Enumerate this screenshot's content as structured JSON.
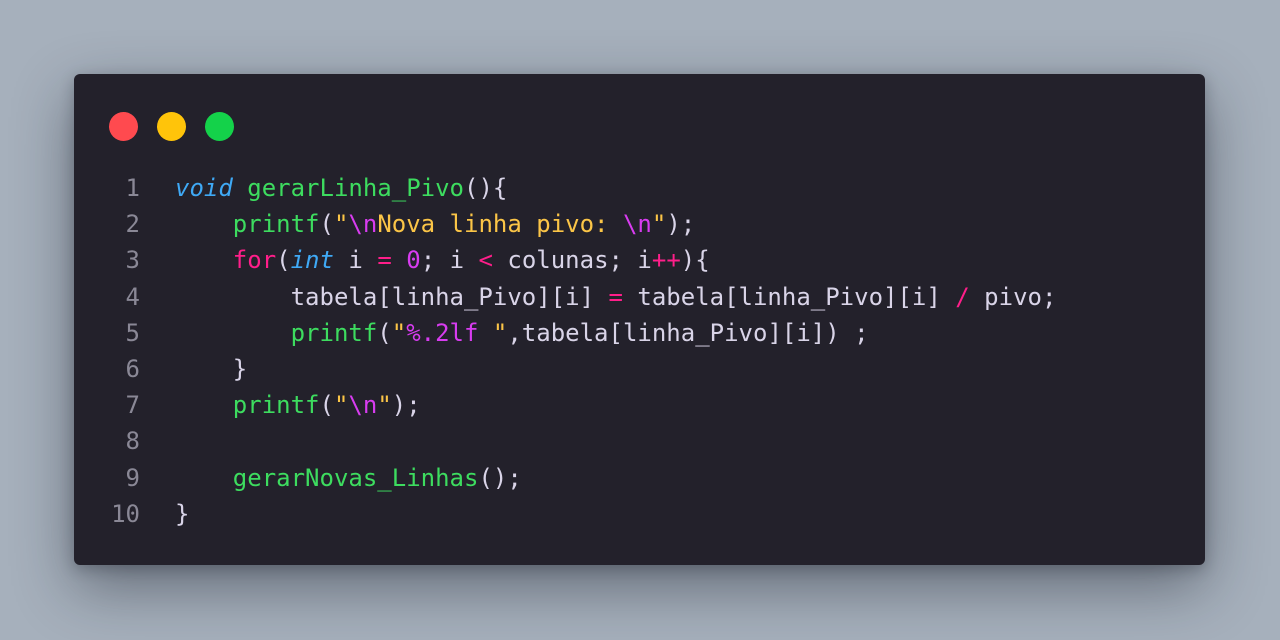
{
  "window": {
    "controls": [
      {
        "name": "close",
        "color": "#ff4a4f"
      },
      {
        "name": "minimize",
        "color": "#ffc40a"
      },
      {
        "name": "maximize",
        "color": "#14d24a"
      }
    ]
  },
  "editor": {
    "lines": [
      {
        "number": "1",
        "indent": "",
        "tokens": [
          {
            "text": "void",
            "type": "kw-type"
          },
          {
            "text": " ",
            "type": "plain"
          },
          {
            "text": "gerarLinha_Pivo",
            "type": "fn"
          },
          {
            "text": "(){",
            "type": "plain"
          }
        ]
      },
      {
        "number": "2",
        "indent": "    ",
        "tokens": [
          {
            "text": "printf",
            "type": "fn"
          },
          {
            "text": "(",
            "type": "plain"
          },
          {
            "text": "\"",
            "type": "str"
          },
          {
            "text": "\\n",
            "type": "esc"
          },
          {
            "text": "Nova linha pivo: ",
            "type": "str"
          },
          {
            "text": "\\n",
            "type": "esc"
          },
          {
            "text": "\"",
            "type": "str"
          },
          {
            "text": ");",
            "type": "plain"
          }
        ]
      },
      {
        "number": "3",
        "indent": "    ",
        "tokens": [
          {
            "text": "for",
            "type": "kw"
          },
          {
            "text": "(",
            "type": "plain"
          },
          {
            "text": "int",
            "type": "kw-type"
          },
          {
            "text": " i ",
            "type": "plain"
          },
          {
            "text": "=",
            "type": "op"
          },
          {
            "text": " ",
            "type": "plain"
          },
          {
            "text": "0",
            "type": "num"
          },
          {
            "text": "; i ",
            "type": "plain"
          },
          {
            "text": "<",
            "type": "op"
          },
          {
            "text": " colunas; i",
            "type": "plain"
          },
          {
            "text": "++",
            "type": "op"
          },
          {
            "text": "){",
            "type": "plain"
          }
        ]
      },
      {
        "number": "4",
        "indent": "        ",
        "tokens": [
          {
            "text": "tabela[linha_Pivo][i] ",
            "type": "plain"
          },
          {
            "text": "=",
            "type": "op"
          },
          {
            "text": " tabela[linha_Pivo][i] ",
            "type": "plain"
          },
          {
            "text": "/",
            "type": "op"
          },
          {
            "text": " pivo;",
            "type": "plain"
          }
        ]
      },
      {
        "number": "5",
        "indent": "        ",
        "tokens": [
          {
            "text": "printf",
            "type": "fn"
          },
          {
            "text": "(",
            "type": "plain"
          },
          {
            "text": "\"",
            "type": "str"
          },
          {
            "text": "%.2lf",
            "type": "esc"
          },
          {
            "text": " \"",
            "type": "str"
          },
          {
            "text": ",tabela[linha_Pivo][i]) ;",
            "type": "plain"
          }
        ]
      },
      {
        "number": "6",
        "indent": "    ",
        "tokens": [
          {
            "text": "}",
            "type": "plain"
          }
        ]
      },
      {
        "number": "7",
        "indent": "    ",
        "tokens": [
          {
            "text": "printf",
            "type": "fn"
          },
          {
            "text": "(",
            "type": "plain"
          },
          {
            "text": "\"",
            "type": "str"
          },
          {
            "text": "\\n",
            "type": "esc"
          },
          {
            "text": "\"",
            "type": "str"
          },
          {
            "text": ");",
            "type": "plain"
          }
        ]
      },
      {
        "number": "8",
        "indent": "",
        "tokens": []
      },
      {
        "number": "9",
        "indent": "    ",
        "tokens": [
          {
            "text": "gerarNovas_Linhas",
            "type": "fn"
          },
          {
            "text": "();",
            "type": "plain"
          }
        ]
      },
      {
        "number": "10",
        "indent": "",
        "tokens": [
          {
            "text": "}",
            "type": "plain"
          }
        ]
      }
    ]
  }
}
